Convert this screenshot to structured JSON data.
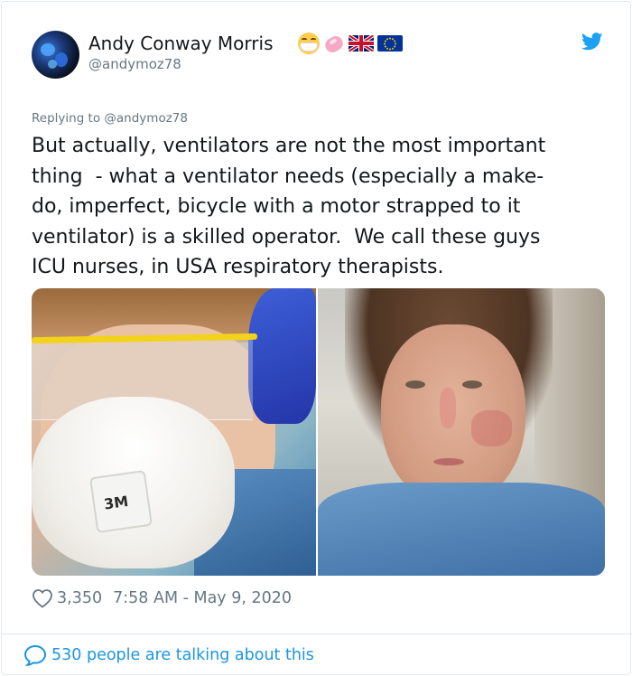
{
  "author": {
    "display_name": "Andy Conway Morris",
    "handle": "@andymoz78",
    "name_emojis": [
      "face-with-medical-mask-icon",
      "soap-icon",
      "uk-flag-icon",
      "eu-flag-icon"
    ]
  },
  "reply_context": {
    "prefix": "Replying to",
    "target": "@andymoz78"
  },
  "tweet": {
    "lines": [
      "But actually, ventilators are not the most important",
      "thing  - what a ventilator needs (especially a make-",
      "do, imperfect, bicycle with a motor strapped to it",
      "ventilator) is a skilled operator.  We call these guys",
      "ICU nurses, in USA respiratory therapists."
    ]
  },
  "media": {
    "left_photo_mask_brand": "3M"
  },
  "meta": {
    "likes": "3,350",
    "timestamp": "7:58 AM - May 9, 2020"
  },
  "footer": {
    "talking_text": "530 people are talking about this"
  },
  "colors": {
    "link_blue": "#1b95e0",
    "muted_gray": "#657786",
    "text": "#14171a",
    "twitter_bird": "#1da1f2"
  }
}
